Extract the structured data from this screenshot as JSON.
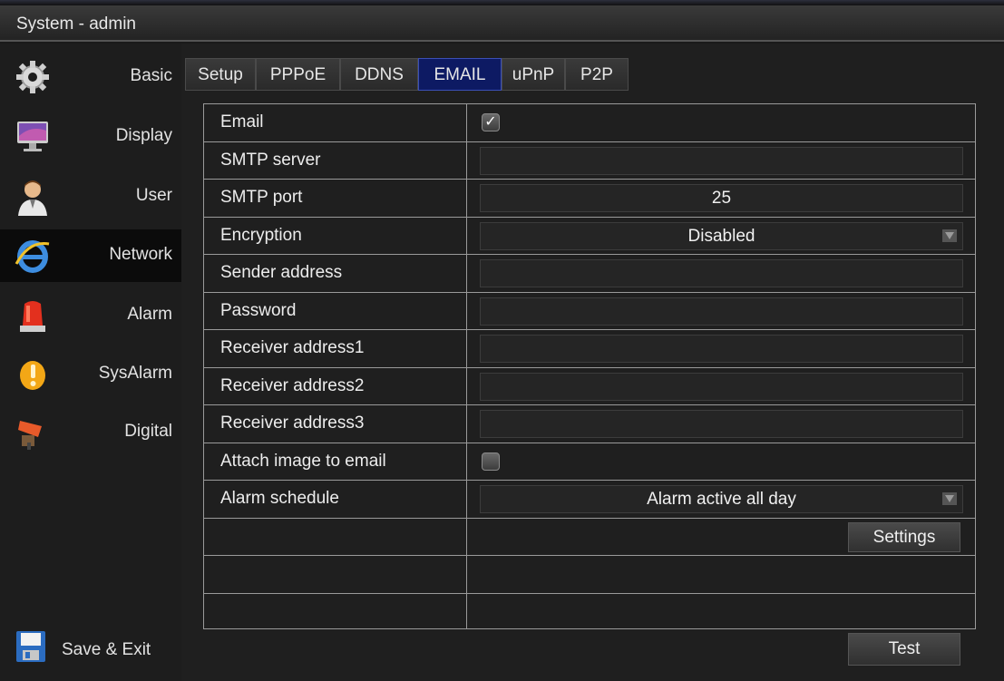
{
  "window": {
    "title": "System - admin"
  },
  "sidebar": {
    "items": [
      {
        "label": "Basic",
        "icon": "gear-icon"
      },
      {
        "label": "Display",
        "icon": "monitor-icon"
      },
      {
        "label": "User",
        "icon": "user-icon"
      },
      {
        "label": "Network",
        "icon": "network-icon"
      },
      {
        "label": "Alarm",
        "icon": "alarm-light-icon"
      },
      {
        "label": "SysAlarm",
        "icon": "warning-icon"
      },
      {
        "label": "Digital",
        "icon": "camera-icon"
      }
    ],
    "active": "Network",
    "save_exit": {
      "label": "Save & Exit",
      "icon": "floppy-disk-icon"
    }
  },
  "tabs": [
    {
      "label": "Setup"
    },
    {
      "label": "PPPoE"
    },
    {
      "label": "DDNS"
    },
    {
      "label": "EMAIL"
    },
    {
      "label": "uPnP"
    },
    {
      "label": "P2P"
    }
  ],
  "active_tab": "EMAIL",
  "form": {
    "email": {
      "label": "Email",
      "checked": true
    },
    "smtp_server": {
      "label": "SMTP server",
      "value": ""
    },
    "smtp_port": {
      "label": "SMTP port",
      "value": "25"
    },
    "encryption": {
      "label": "Encryption",
      "value": "Disabled"
    },
    "sender_address": {
      "label": "Sender address",
      "value": ""
    },
    "password": {
      "label": "Password",
      "value": ""
    },
    "receiver1": {
      "label": "Receiver address1",
      "value": ""
    },
    "receiver2": {
      "label": "Receiver address2",
      "value": ""
    },
    "receiver3": {
      "label": "Receiver address3",
      "value": ""
    },
    "attach_image": {
      "label": "Attach image to email",
      "checked": false
    },
    "alarm_schedule": {
      "label": "Alarm schedule",
      "value": "Alarm active all day"
    },
    "settings_button": "Settings"
  },
  "test_button": "Test",
  "colors": {
    "active_tab": "#0d1a63",
    "background": "#1f1f1f",
    "grid_line": "#9a9a9a"
  }
}
